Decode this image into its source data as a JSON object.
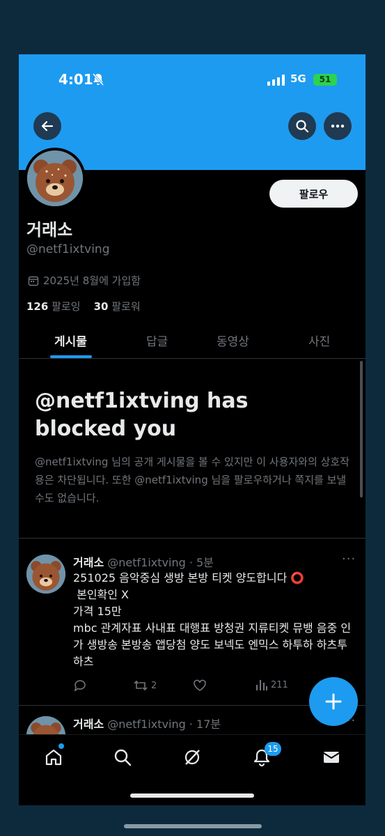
{
  "status_bar": {
    "time": "4:01",
    "network": "5G",
    "battery": "51"
  },
  "profile": {
    "name": "거래소",
    "handle": "@netf1ixtving",
    "joined": "2025년 8월에 가입함",
    "following_count": "126",
    "following_label": "팔로잉",
    "followers_count": "30",
    "followers_label": "팔로워",
    "follow_button": "팔로우"
  },
  "tabs": [
    {
      "label": "게시물"
    },
    {
      "label": "답글"
    },
    {
      "label": "동영상"
    },
    {
      "label": "사진"
    }
  ],
  "blocked": {
    "title": "@netf1ixtving has blocked you",
    "description": "@netf1ixtving 님의 공개 게시물을 볼 수 있지만 이 사용자와의 상호작용은 차단됩니다. 또한 @netf1ixtving 님을 팔로우하거나 쪽지를 보낼 수도 없습니다."
  },
  "posts": [
    {
      "author": "거래소",
      "handle": "@netf1ixtving",
      "time": "· 5분",
      "lines": [
        "251025 음악중심 생방 본방 티켓 양도합니다 ⭕",
        " 본인확인 X",
        "가격 15만",
        "mbc 관계자표 사내표 대행표 방청권 지류티켓 뮤뱅 음중 인가 생방송 본방송 앱당첨 양도 보넥도 엔믹스 하투하 하츠투하츠"
      ],
      "retweets": "2",
      "views": "211"
    },
    {
      "author": "거래소",
      "handle": "@netf1ixtving",
      "time": "· 17분"
    }
  ],
  "bottom_nav": {
    "notifications_badge": "15"
  },
  "colors": {
    "accent": "#1d9bf0",
    "background": "#000000",
    "outer": "#0d2a3d"
  }
}
